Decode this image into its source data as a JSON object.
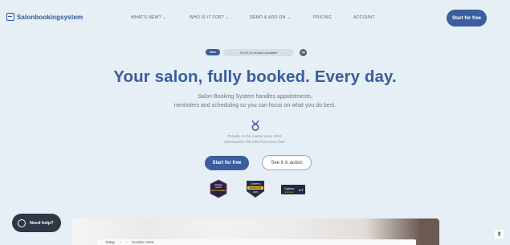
{
  "header": {
    "logo_text": "Salonbookingsystem",
    "nav": [
      {
        "label": "WHAT'S NEW?",
        "has_dropdown": true
      },
      {
        "label": "WHO IS IT FOR?",
        "has_dropdown": true
      },
      {
        "label": "DEMO & ADD-ON",
        "has_dropdown": true
      },
      {
        "label": "PRICING",
        "has_dropdown": false
      },
      {
        "label": "ACCOUNT",
        "has_dropdown": false
      }
    ],
    "cta": "Start for free"
  },
  "version": {
    "badge": "New",
    "text": "10.30.24 version available"
  },
  "hero": {
    "title": "Your salon, fully booked. Every day.",
    "subtitle_line1": "Salon Booking System handles appointments,",
    "subtitle_line2": "reminders and scheduling so you can focus on what you do best.",
    "since_line1": "Proudly on the market since 2016",
    "since_line2": "downloaded 760,198 times since then",
    "primary_button": "Start for free",
    "secondary_button": "See it in action"
  },
  "badges": [
    {
      "name": "software-advice-badge",
      "line1": "Software",
      "line2": "Advice",
      "line3": "FRONT RUNNERS"
    },
    {
      "name": "capterra-shortlist-badge",
      "line1": "Capterra",
      "line2": "SHORTLIST",
      "line3": "2023"
    },
    {
      "name": "capterra-rating-badge",
      "line1": "Capterra",
      "rating": "4.7"
    }
  ],
  "chat": {
    "label": "Need help?"
  },
  "preview": {
    "toolbar_label": "Today",
    "date": "October 2023"
  },
  "colors": {
    "brand": "#3a5e9e",
    "background": "#e6eef6",
    "chat_bg": "#2d3a46",
    "scroll_icon": "#1b9b5a"
  }
}
